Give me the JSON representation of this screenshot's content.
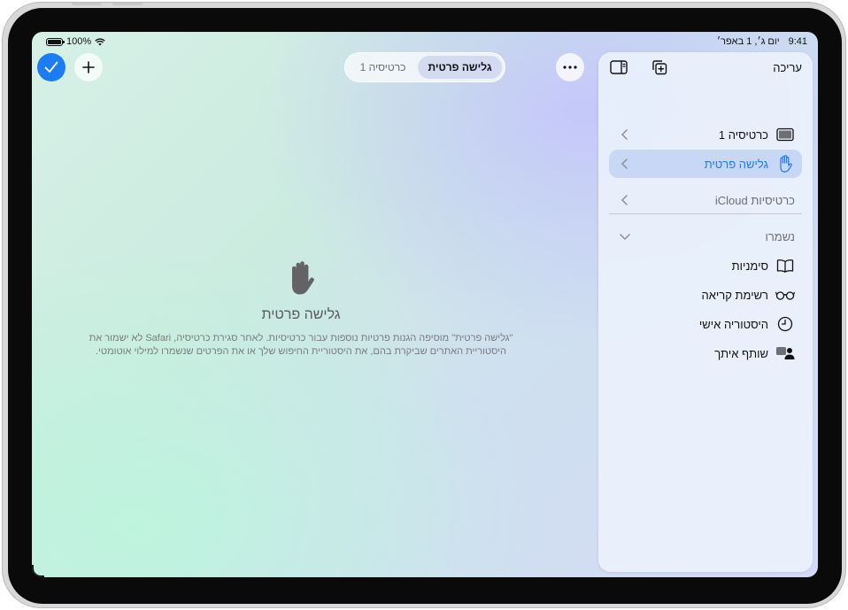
{
  "status_bar": {
    "time": "9:41",
    "date": "יום ג׳, 1 באפר׳",
    "battery": "100%"
  },
  "tabs": {
    "active": "גלישה פרטית",
    "inactive": "כרטיסיה 1"
  },
  "empty_state": {
    "title": "גלישה פרטית",
    "line1": "\"גלישה פרטית\" מוסיפה הגנות פרטיות נוספות עבור כרטיסיות. לאחר סגירת כרטיסיה, Safari לא ישמור את",
    "line2": "היסטוריית האתרים שביקרת בהם, את היסטוריית החיפוש שלך או את הפרטים שנשמרו למילוי אוטומטי."
  },
  "sidebar": {
    "edit_label": "עריכה",
    "items": [
      {
        "label": "כרטיסיה 1",
        "icon": "tablet-icon"
      },
      {
        "label": "גלישה פרטית",
        "icon": "hand-icon"
      },
      {
        "label": "כרטיסיות iCloud",
        "icon": "none"
      }
    ],
    "saved_header": "נשמרו",
    "saved_items": [
      {
        "label": "סימניות",
        "icon": "book-icon"
      },
      {
        "label": "רשימת קריאה",
        "icon": "glasses-icon"
      },
      {
        "label": "היסטוריה אישי",
        "icon": "clock-icon"
      },
      {
        "label": "שותף איתך",
        "icon": "shared-with-you-icon"
      }
    ]
  },
  "colors": {
    "accent": "#1d7cf2"
  }
}
